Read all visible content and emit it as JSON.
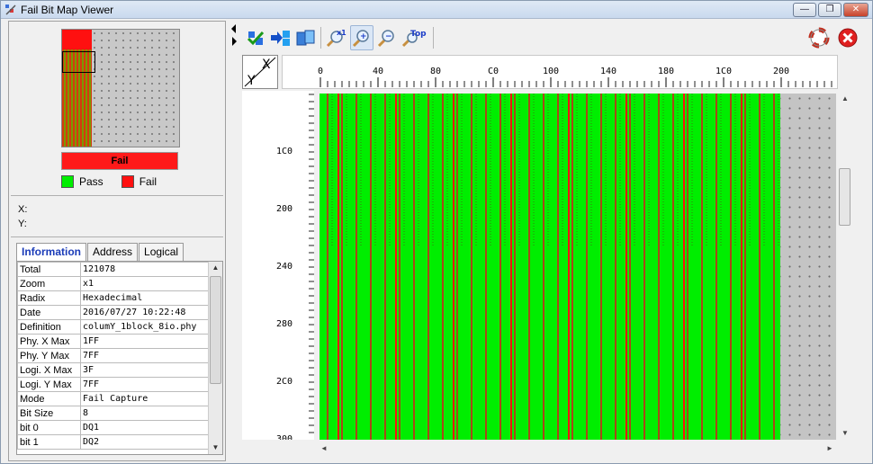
{
  "window": {
    "title": "Fail Bit Map Viewer"
  },
  "title_buttons": {
    "minimize": "—",
    "restore": "❐",
    "close": "✕"
  },
  "overview": {
    "fail_bar_label": "Fail",
    "legend": [
      {
        "label": "Pass",
        "color": "#00ee00"
      },
      {
        "label": "Fail",
        "color": "#ff1010"
      }
    ]
  },
  "cursor": {
    "x_label": "X:",
    "y_label": "Y:",
    "x_value": "",
    "y_value": ""
  },
  "tabs": [
    {
      "label": "Information",
      "active": true
    },
    {
      "label": "Address",
      "active": false
    },
    {
      "label": "Logical",
      "active": false
    }
  ],
  "info": [
    {
      "key": "Total",
      "value": "121078"
    },
    {
      "key": "Zoom",
      "value": "x1"
    },
    {
      "key": "Radix",
      "value": "Hexadecimal"
    },
    {
      "key": "Date",
      "value": "2016/07/27 10:22:48"
    },
    {
      "key": "Definition",
      "value": "columY_1block_8io.phy"
    },
    {
      "key": "Phy. X Max",
      "value": "1FF"
    },
    {
      "key": "Phy. Y Max",
      "value": "7FF"
    },
    {
      "key": "Logi. X Max",
      "value": "3F"
    },
    {
      "key": "Logi. Y Max",
      "value": "7FF"
    },
    {
      "key": "Mode",
      "value": "Fail Capture"
    },
    {
      "key": "Bit Size",
      "value": "8"
    },
    {
      "key": "bit 0",
      "value": "DQ1"
    },
    {
      "key": "bit 1",
      "value": "DQ2"
    }
  ],
  "toolbar": {
    "tools": [
      {
        "name": "pass-fail-toggle-icon",
        "label": ""
      },
      {
        "name": "move-right-icon",
        "label": ""
      },
      {
        "name": "copy-blocks-icon",
        "label": ""
      },
      {
        "name": "zoom-x1-icon",
        "label": "x1"
      },
      {
        "name": "zoom-in-icon",
        "label": "+"
      },
      {
        "name": "zoom-out-icon",
        "label": "−"
      },
      {
        "name": "zoom-top-icon",
        "label": "Top"
      }
    ]
  },
  "axes": {
    "corner_x": "X",
    "corner_y": "Y",
    "x_ticks": [
      "0",
      "40",
      "80",
      "C0",
      "100",
      "140",
      "180",
      "1C0",
      "200"
    ],
    "y_ticks": [
      "1C0",
      "200",
      "240",
      "280",
      "2C0",
      "300"
    ]
  },
  "colors": {
    "pass": "#00ee00",
    "fail": "#ff1010",
    "empty": "#c4c4c4"
  }
}
